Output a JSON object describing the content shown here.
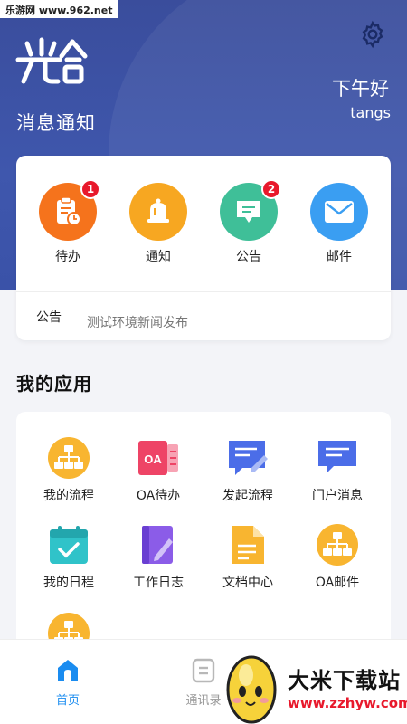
{
  "watermark_top": "乐游网 www.962.net",
  "header": {
    "logo_text": "光合",
    "subtitle": "消息通知",
    "greeting": "下午好",
    "username": "tangs"
  },
  "quick_actions": [
    {
      "label": "待办",
      "badge": "1",
      "color": "#f5731c",
      "icon": "clipboard-clock-icon"
    },
    {
      "label": "通知",
      "badge": "",
      "color": "#f7a721",
      "icon": "bell-icon"
    },
    {
      "label": "公告",
      "badge": "2",
      "color": "#3fbf98",
      "icon": "message-bubble-icon"
    },
    {
      "label": "邮件",
      "badge": "",
      "color": "#3a9ef2",
      "icon": "mail-icon"
    }
  ],
  "notice": {
    "label": "公告",
    "text": "测试环境新闻发布"
  },
  "apps_section_title": "我的应用",
  "apps": [
    {
      "label": "我的流程",
      "icon": "org-chart-icon"
    },
    {
      "label": "OA待办",
      "icon": "oa-icon"
    },
    {
      "label": "发起流程",
      "icon": "edit-document-icon"
    },
    {
      "label": "门户消息",
      "icon": "message-icon"
    },
    {
      "label": "我的日程",
      "icon": "calendar-check-icon"
    },
    {
      "label": "工作日志",
      "icon": "journal-edit-icon"
    },
    {
      "label": "文档中心",
      "icon": "document-icon"
    },
    {
      "label": "OA邮件",
      "icon": "org-chart-icon"
    }
  ],
  "tabbar": {
    "home_label": "首页",
    "contacts_label": "通讯录"
  },
  "watermark_bottom": {
    "brand": "大米下载站",
    "url": "www.zzhyw.com"
  },
  "colors": {
    "header_blue": "#3f57ad",
    "active_tab": "#1a8cf0",
    "badge_red": "#e8192c"
  }
}
